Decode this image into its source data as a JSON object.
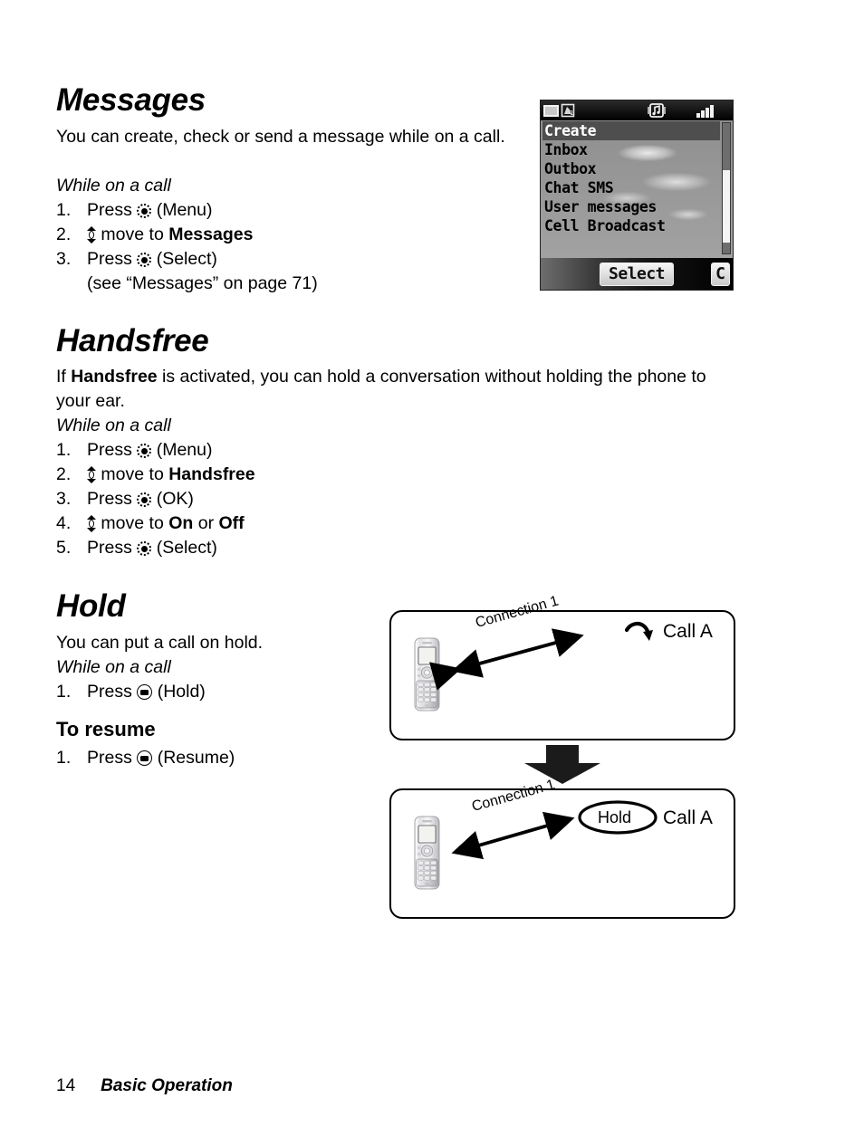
{
  "sections": {
    "messages": {
      "heading": "Messages",
      "intro": "You can create, check or send a message while on a call.",
      "condition": "While on a call",
      "steps": [
        {
          "num": "1.",
          "pre": "Press",
          "icon": "center-select-key-icon",
          "post": "(Menu)"
        },
        {
          "num": "2.",
          "pre": "",
          "icon": "up-down-navigation-key-icon",
          "post": "move to",
          "bold": "Messages"
        },
        {
          "num": "3.",
          "pre": "Press",
          "icon": "center-select-key-icon",
          "post": "(Select)"
        }
      ],
      "cross_reference": "(see “Messages” on page 71)"
    },
    "handsfree": {
      "heading": "Handsfree",
      "intro_pre": "If ",
      "intro_bold": "Handsfree",
      "intro_post": " is activated, you can hold a conversation without holding the phone to your ear.",
      "condition": "While on a call",
      "steps": [
        {
          "num": "1.",
          "pre": "Press",
          "icon": "center-select-key-icon",
          "post": "(Menu)"
        },
        {
          "num": "2.",
          "pre": "",
          "icon": "up-down-navigation-key-icon",
          "post": "move to",
          "bold": "Handsfree"
        },
        {
          "num": "3.",
          "pre": "Press",
          "icon": "center-select-key-icon",
          "post": "(OK)"
        },
        {
          "num": "4.",
          "pre": "",
          "icon": "up-down-navigation-key-icon",
          "post": "move to",
          "bold": "On",
          "mid": "or",
          "bold2": "Off"
        },
        {
          "num": "5.",
          "pre": "Press",
          "icon": "center-select-key-icon",
          "post": "(Select)"
        }
      ]
    },
    "hold": {
      "heading": "Hold",
      "intro": "You can put a call on hold.",
      "condition": "While on a call",
      "steps": [
        {
          "num": "1.",
          "pre": "Press",
          "icon": "soft-key-icon",
          "post": "(Hold)"
        }
      ],
      "subheading": "To resume",
      "resume_steps": [
        {
          "num": "1.",
          "pre": "Press",
          "icon": "soft-key-icon",
          "post": "(Resume)"
        }
      ]
    }
  },
  "phone_screenshot": {
    "status_icons": [
      "battery-icon",
      "sim-card-1-icon",
      "music-tone-icon",
      "signal-strength-icon"
    ],
    "sim_label": "1",
    "menu_items": [
      {
        "label": "Create",
        "selected": true
      },
      {
        "label": "Inbox",
        "selected": false
      },
      {
        "label": "Outbox",
        "selected": false
      },
      {
        "label": "Chat SMS",
        "selected": false
      },
      {
        "label": "User messages",
        "selected": false
      },
      {
        "label": "Cell Broadcast",
        "selected": false
      }
    ],
    "softkey_center": "Select",
    "softkey_right": "C"
  },
  "diagram": {
    "box1": {
      "connection_label": "Connection 1",
      "call_label": "Call A",
      "phone": "mobile-phone-illustration",
      "marker": "curved-call-arrow-icon"
    },
    "transition_icon": "down-arrow-icon",
    "box2": {
      "connection_label": "Connection 1",
      "hold_label": "Hold",
      "call_label": "Call A",
      "phone": "mobile-phone-illustration"
    }
  },
  "footer": {
    "page_number": "14",
    "section_name": "Basic Operation"
  }
}
